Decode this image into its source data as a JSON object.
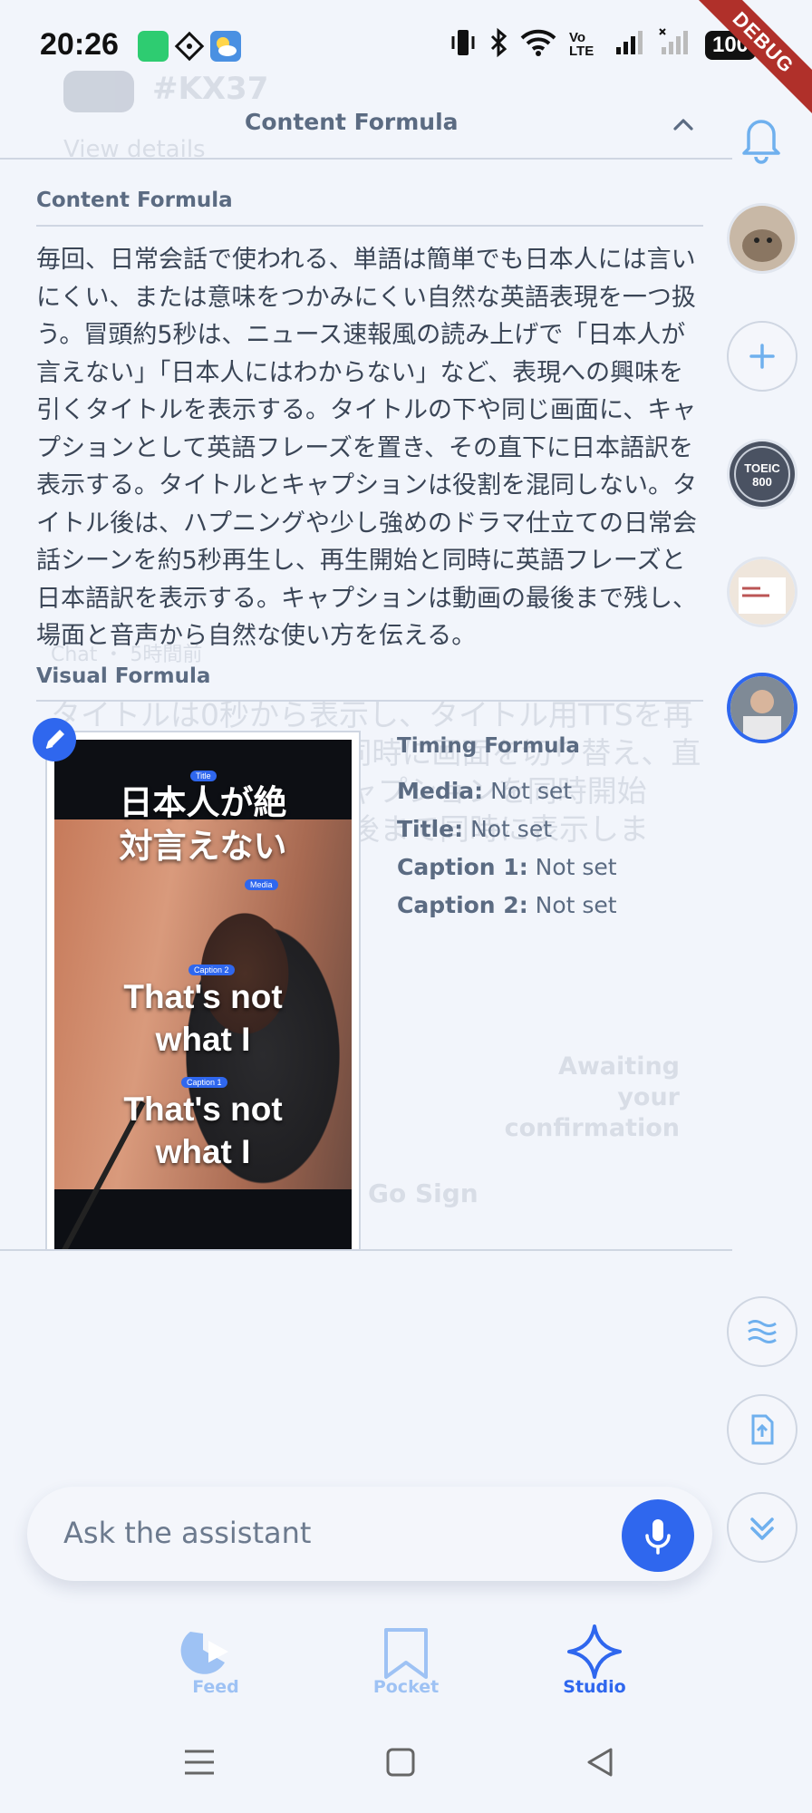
{
  "status_bar": {
    "time": "20:26",
    "battery": "100",
    "ribbon": "DEBUG"
  },
  "background": {
    "heading": "#KX37",
    "view_details": "View details",
    "chat_meta": "Chat ・ 5時間前",
    "body_text": "タイトルは0秒から表示し、タイトル用TTSを再生します。TTS終了と同時に画面を切り替え、直後にメディア再生とキャプションを同時開始し、キャプションは最後まで同時に表示します。",
    "awaiting": "Awaiting your confirmation",
    "go_sign": "Go Sign"
  },
  "panel": {
    "title": "Content Formula",
    "content_formula_label": "Content Formula",
    "content_formula_text": "毎回、日常会話で使われる、単語は簡単でも日本人には言いにくい、または意味をつかみにくい自然な英語表現を一つ扱う。冒頭約5秒は、ニュース速報風の読み上げで「日本人が言えない」「日本人にはわからない」など、表現への興味を引くタイトルを表示する。タイトルの下や同じ画面に、キャプションとして英語フレーズを置き、その直下に日本語訳を表示する。タイトルとキャプションは役割を混同しない。タイトル後は、ハプニングや少し強めのドラマ仕立ての日常会話シーンを約5秒再生し、再生開始と同時に英語フレーズと日本語訳を表示する。キャプションは動画の最後まで残し、場面と音声から自然な使い方を伝える。",
    "visual_formula_label": "Visual Formula"
  },
  "preview": {
    "tag_title": "Title",
    "title_line1": "日本人が絶",
    "title_line2": "対言えない",
    "tag_media": "Media",
    "tag_caption2": "Caption 2",
    "caption2_line1": "That's not",
    "caption2_line2": "what I",
    "tag_caption1": "Caption 1",
    "caption1_line1": "That's not",
    "caption1_line2": "what I"
  },
  "timing": {
    "title": "Timing Formula",
    "rows": [
      {
        "label": "Media:",
        "value": "Not set"
      },
      {
        "label": "Title:",
        "value": "Not set"
      },
      {
        "label": "Caption 1:",
        "value": "Not set"
      },
      {
        "label": "Caption 2:",
        "value": "Not set"
      }
    ]
  },
  "rail": {
    "avatar3_text": "TOEIC 800"
  },
  "assistant": {
    "placeholder": "Ask the assistant"
  },
  "nav": {
    "feed": "Feed",
    "pocket": "Pocket",
    "studio": "Studio"
  },
  "colors": {
    "accent": "#2f67ee",
    "nav_inactive": "#9ec2f4",
    "text_muted": "#5b6b82"
  }
}
